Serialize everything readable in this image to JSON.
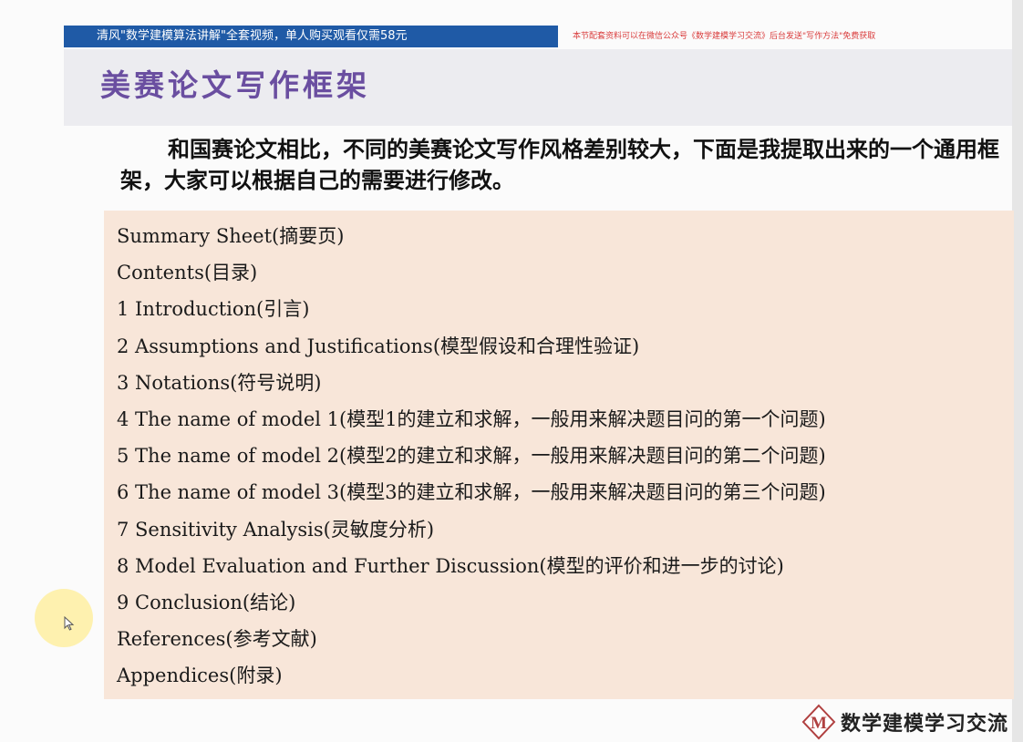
{
  "header": {
    "promo_banner": "清风\"数学建模算法讲解\"全套视频，单人购买观看仅需58元",
    "promo_note": "本节配套资料可以在微信公众号《数学建模学习交流》后台发送\"写作方法\"免费获取"
  },
  "slide": {
    "title": "美赛论文写作框架",
    "intro": "和国赛论文相比，不同的美赛论文写作风格差别较大，下面是我提取出来的一个通用框架，大家可以根据自己的需要进行修改。",
    "outline": [
      "Summary Sheet(摘要页)",
      "Contents(目录)",
      "1 Introduction(引言)",
      "2 Assumptions and Justifications(模型假设和合理性验证)",
      "3 Notations(符号说明)",
      "4 The name of model 1(模型1的建立和求解，一般用来解决题目问的第一个问题)",
      "5 The name of model 2(模型2的建立和求解，一般用来解决题目问的第二个问题)",
      "6 The name of model 3(模型3的建立和求解，一般用来解决题目问的第三个问题)",
      "7 Sensitivity Analysis(灵敏度分析)",
      "8 Model Evaluation and Further Discussion(模型的评价和进一步的讨论)",
      "9 Conclusion(结论)",
      "References(参考文献)",
      "Appendices(附录)"
    ]
  },
  "watermark": {
    "logo_letter": "M",
    "text": "数学建模学习交流"
  },
  "colors": {
    "banner": "#1f5aa6",
    "title": "#6a4ea0",
    "note": "#d93b3b",
    "outline_bg": "#f8e6d9"
  },
  "icons": {
    "cursor": "mouse-pointer-icon",
    "logo": "m-logo-icon"
  }
}
